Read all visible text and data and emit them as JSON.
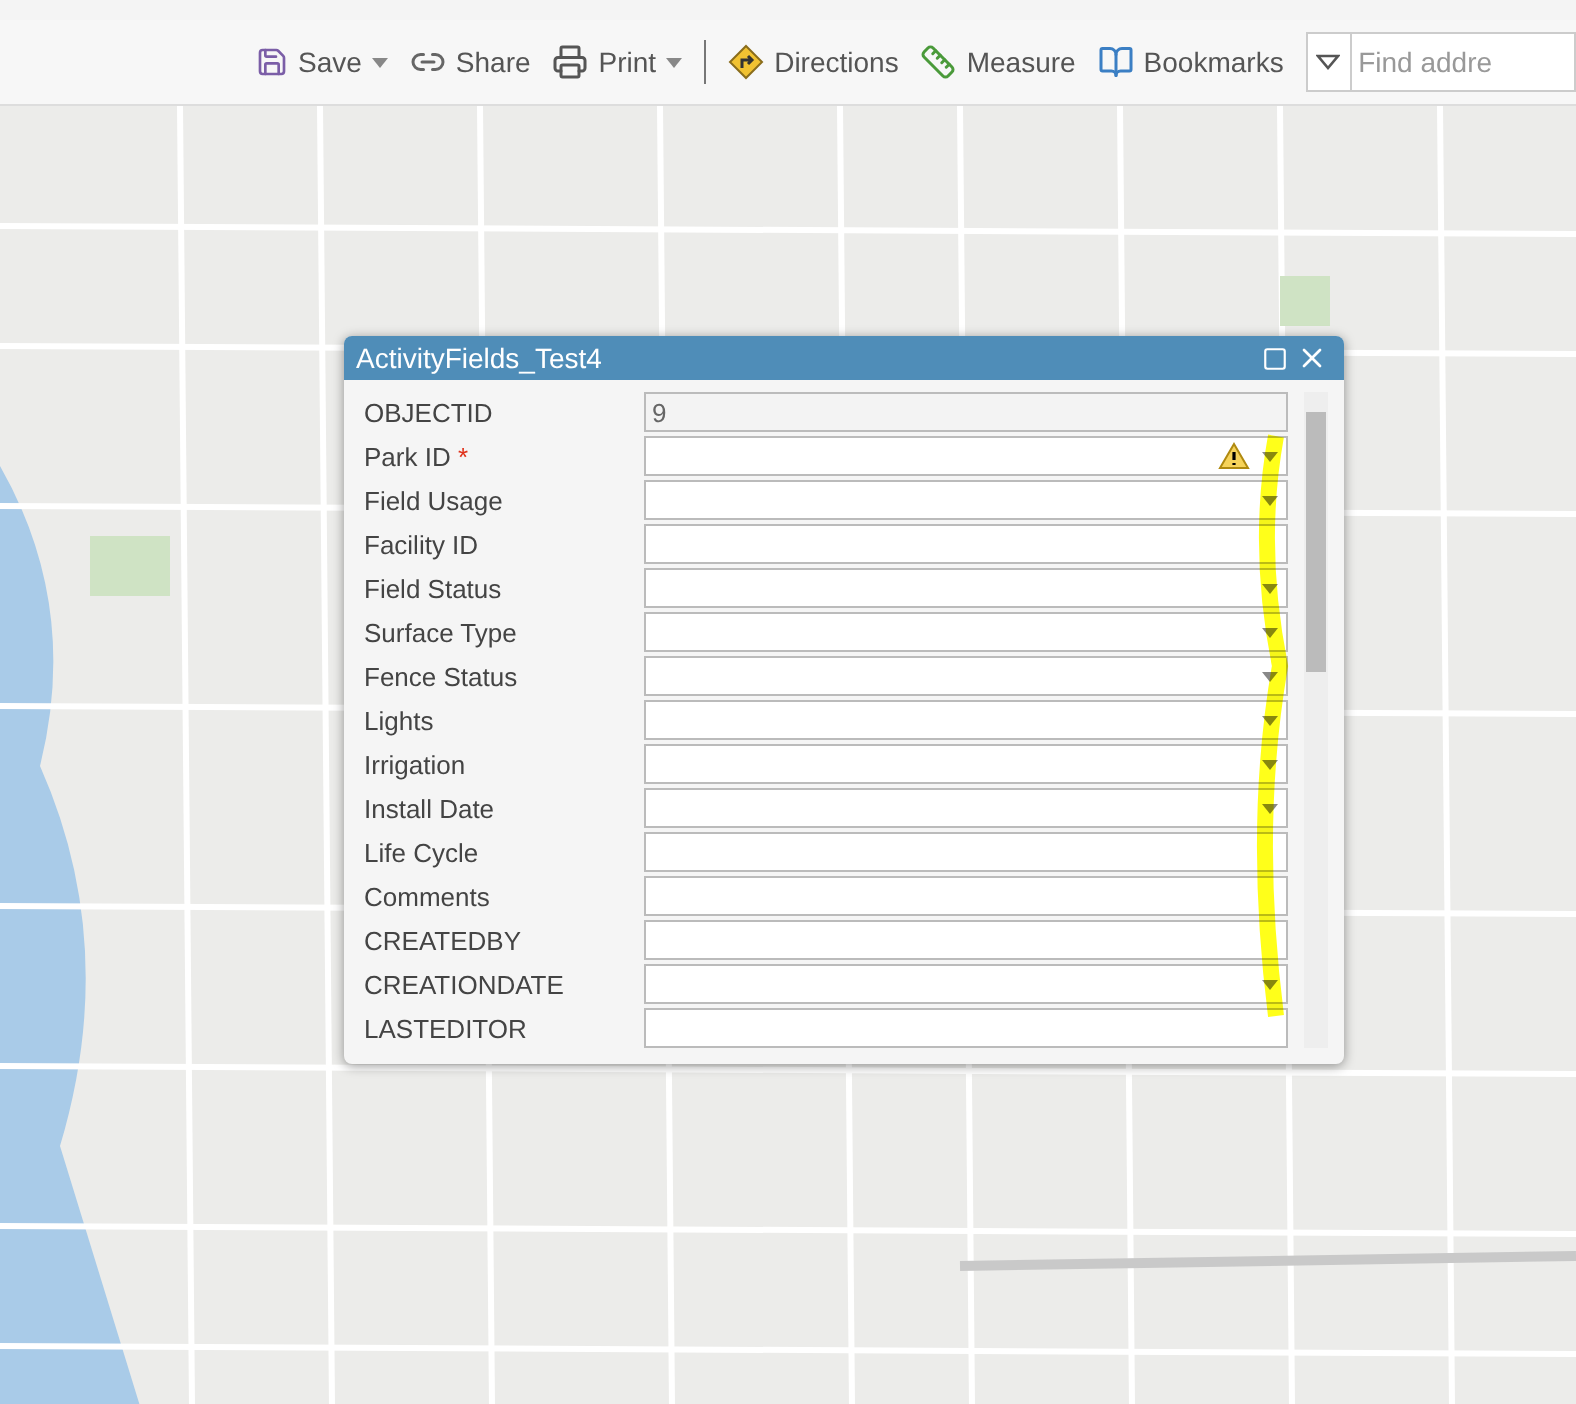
{
  "toolbar": {
    "items": [
      {
        "kind": "save",
        "label": "Save",
        "dropdown": true
      },
      {
        "kind": "share",
        "label": "Share",
        "dropdown": false
      },
      {
        "kind": "print",
        "label": "Print",
        "dropdown": true
      },
      {
        "kind": "directions",
        "label": "Directions",
        "dropdown": false
      },
      {
        "kind": "measure",
        "label": "Measure",
        "dropdown": false
      },
      {
        "kind": "bookmarks",
        "label": "Bookmarks",
        "dropdown": false
      }
    ],
    "search": {
      "placeholder": "Find addre"
    }
  },
  "popup": {
    "title": "ActivityFields_Test4",
    "required_mark": "*",
    "fields": [
      {
        "label": "OBJECTID",
        "kind": "readonly",
        "value": "9",
        "required": false,
        "warning": false
      },
      {
        "label": "Park ID",
        "kind": "select",
        "required": true,
        "warning": true
      },
      {
        "label": "Field Usage",
        "kind": "select",
        "required": false,
        "warning": false
      },
      {
        "label": "Facility ID",
        "kind": "text",
        "required": false,
        "warning": false
      },
      {
        "label": "Field Status",
        "kind": "select",
        "required": false,
        "warning": false
      },
      {
        "label": "Surface Type",
        "kind": "select",
        "required": false,
        "warning": false
      },
      {
        "label": "Fence Status",
        "kind": "select",
        "required": false,
        "warning": false
      },
      {
        "label": "Lights",
        "kind": "select",
        "required": false,
        "warning": false
      },
      {
        "label": "Irrigation",
        "kind": "select",
        "required": false,
        "warning": false
      },
      {
        "label": "Install Date",
        "kind": "date",
        "required": false,
        "warning": false
      },
      {
        "label": "Life Cycle",
        "kind": "text",
        "required": false,
        "warning": false
      },
      {
        "label": "Comments",
        "kind": "text",
        "required": false,
        "warning": false
      },
      {
        "label": "CREATEDBY",
        "kind": "text",
        "required": false,
        "warning": false
      },
      {
        "label": "CREATIONDATE",
        "kind": "date",
        "required": false,
        "warning": false
      },
      {
        "label": "LASTEDITOR",
        "kind": "text",
        "required": false,
        "warning": false
      }
    ]
  }
}
